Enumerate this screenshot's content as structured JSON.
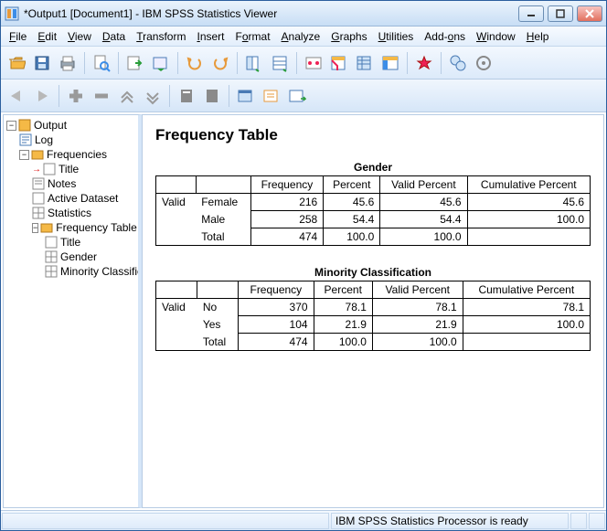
{
  "window": {
    "title": "*Output1 [Document1] - IBM SPSS Statistics Viewer",
    "min": "—",
    "max": "□",
    "close": "X"
  },
  "menu": {
    "file": "File",
    "edit": "Edit",
    "view": "View",
    "data": "Data",
    "transform": "Transform",
    "insert": "Insert",
    "format": "Format",
    "analyze": "Analyze",
    "graphs": "Graphs",
    "utilities": "Utilities",
    "addons": "Add-ons",
    "window": "Window",
    "help": "Help"
  },
  "tree": {
    "root": "Output",
    "log": "Log",
    "freq": "Frequencies",
    "title": "Title",
    "notes": "Notes",
    "active": "Active Dataset",
    "stats": "Statistics",
    "ftable": "Frequency Table",
    "ft_title": "Title",
    "ft_gender": "Gender",
    "ft_min": "Minority Classification"
  },
  "doc": {
    "heading": "Frequency Table",
    "tables": [
      {
        "caption": "Gender",
        "stub": "Valid",
        "headers": [
          "Frequency",
          "Percent",
          "Valid Percent",
          "Cumulative Percent"
        ],
        "rows": [
          {
            "label": "Female",
            "cells": [
              "216",
              "45.6",
              "45.6",
              "45.6"
            ]
          },
          {
            "label": "Male",
            "cells": [
              "258",
              "54.4",
              "54.4",
              "100.0"
            ]
          },
          {
            "label": "Total",
            "cells": [
              "474",
              "100.0",
              "100.0",
              ""
            ]
          }
        ]
      },
      {
        "caption": "Minority Classification",
        "stub": "Valid",
        "headers": [
          "Frequency",
          "Percent",
          "Valid Percent",
          "Cumulative Percent"
        ],
        "rows": [
          {
            "label": "No",
            "cells": [
              "370",
              "78.1",
              "78.1",
              "78.1"
            ]
          },
          {
            "label": "Yes",
            "cells": [
              "104",
              "21.9",
              "21.9",
              "100.0"
            ]
          },
          {
            "label": "Total",
            "cells": [
              "474",
              "100.0",
              "100.0",
              ""
            ]
          }
        ]
      }
    ]
  },
  "status": {
    "processor": "IBM SPSS Statistics Processor is ready"
  }
}
